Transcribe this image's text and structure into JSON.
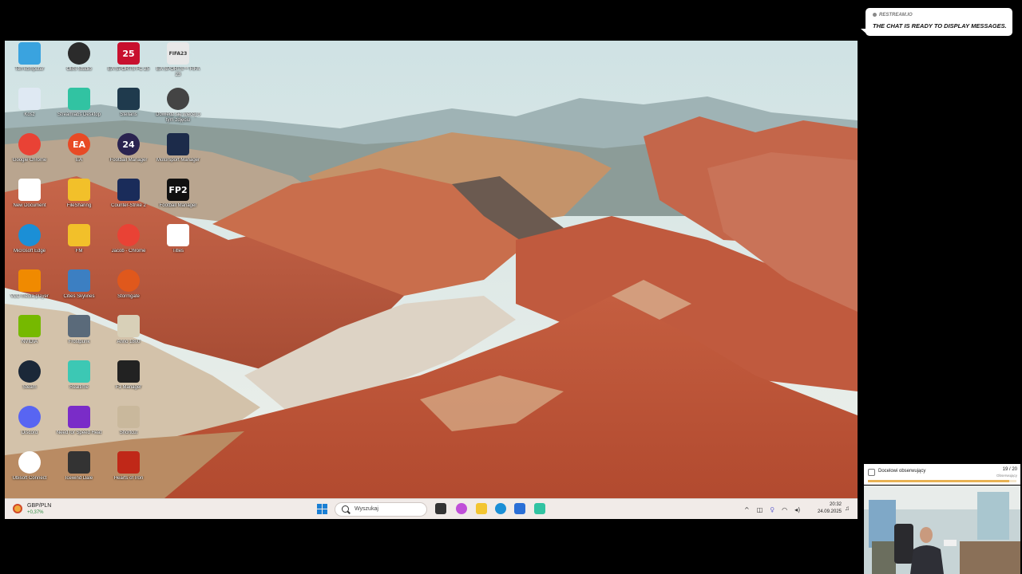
{
  "desktop": {
    "icons": [
      {
        "label": "Ten komputer",
        "icon": "monitor-icon",
        "color": "#3aa3df"
      },
      {
        "label": "OBS Studio",
        "icon": "obs-icon",
        "color": "#2b2b2b"
      },
      {
        "label": "EA SPORTS FC 25",
        "icon": "fc25-icon",
        "color": "#c8102e",
        "text": "25"
      },
      {
        "label": "EA SPORTS™ FIFA 23",
        "icon": "fifa23-icon",
        "color": "#e8e8e8",
        "text": "FIFA23"
      },
      {
        "label": "Kosz",
        "icon": "recycle-bin-icon",
        "color": "#dfe9f3"
      },
      {
        "label": "Streamlabs Desktop",
        "icon": "streamlabs-icon",
        "color": "#31c3a2"
      },
      {
        "label": "Stellaris",
        "icon": "stellaris-icon",
        "color": "#1f3a4d"
      },
      {
        "label": "Dowiedz się więcej o tym zdjęciu",
        "icon": "camera-icon",
        "color": "#444444"
      },
      {
        "label": "Google Chrome",
        "icon": "chrome-icon",
        "color": "#e94235"
      },
      {
        "label": "EA",
        "icon": "ea-icon",
        "color": "#e84a25",
        "text": "EA"
      },
      {
        "label": "Football Manager",
        "icon": "fm24-icon",
        "color": "#2a2350",
        "text": "24"
      },
      {
        "label": "Motorsport Manager",
        "icon": "mm-icon",
        "color": "#1c2b4a"
      },
      {
        "label": "New Document",
        "icon": "document-icon",
        "color": "#ffffff"
      },
      {
        "label": "FileSharing",
        "icon": "folder-icon",
        "color": "#f2c02a"
      },
      {
        "label": "Counter-Strike 2",
        "icon": "cs2-icon",
        "color": "#1a2c5a"
      },
      {
        "label": "Football Manager",
        "icon": "fm2-icon",
        "color": "#111111",
        "text": "FP2"
      },
      {
        "label": "Microsoft Edge",
        "icon": "edge-icon",
        "color": "#1b8fd6"
      },
      {
        "label": "FM",
        "icon": "folder-icon",
        "color": "#f2c02a"
      },
      {
        "label": "Jacob - Chrome",
        "icon": "chrome-profile-icon",
        "color": "#e94235"
      },
      {
        "label": "Titles",
        "icon": "document-icon",
        "color": "#ffffff"
      },
      {
        "label": "VLC media player",
        "icon": "vlc-icon",
        "color": "#f08a00"
      },
      {
        "label": "Cities Skylines",
        "icon": "cities-icon",
        "color": "#3c7fc2"
      },
      {
        "label": "Stormgate",
        "icon": "stormgate-icon",
        "color": "#e0581c"
      },
      {
        "label": "NVIDIA",
        "icon": "nvidia-icon",
        "color": "#76b900"
      },
      {
        "label": "Frostpunk",
        "icon": "frostpunk-icon",
        "color": "#5a6a7a"
      },
      {
        "label": "Anno 1800",
        "icon": "anno-icon",
        "color": "#d8d0b8"
      },
      {
        "label": "Steam",
        "icon": "steam-icon",
        "color": "#1b2838"
      },
      {
        "label": "Realtime",
        "icon": "realtime-icon",
        "color": "#3cc8b4"
      },
      {
        "label": "F1 Manager",
        "icon": "f1-icon",
        "color": "#222222"
      },
      {
        "label": "Discord",
        "icon": "discord-icon",
        "color": "#5865f2"
      },
      {
        "label": "Need for Speed Heat",
        "icon": "nfs-icon",
        "color": "#7a2cc8"
      },
      {
        "label": "Shortcut",
        "icon": "shortcut-icon",
        "color": "#c9b89c"
      },
      {
        "label": "Ubisoft Connect",
        "icon": "ubisoft-icon",
        "color": "#ffffff"
      },
      {
        "label": "Icewind Dale",
        "icon": "game-icon",
        "color": "#333333"
      },
      {
        "label": "Hearts of Iron",
        "icon": "hoi-icon",
        "color": "#c02818"
      }
    ]
  },
  "taskbar": {
    "weather": {
      "title": "GBP/PLN",
      "change": "+0,37%"
    },
    "search_placeholder": "Wyszukaj",
    "apps": [
      {
        "icon": "task-view-icon",
        "color": "#333333"
      },
      {
        "icon": "copilot-icon",
        "color": "#c04fd8"
      },
      {
        "icon": "file-explorer-icon",
        "color": "#f3c531"
      },
      {
        "icon": "edge-icon",
        "color": "#1b8fd6"
      },
      {
        "icon": "store-icon",
        "color": "#2a6fd6"
      },
      {
        "icon": "streamlabs-icon",
        "color": "#31c3a2"
      }
    ],
    "tray_icons": [
      "chevron-up-icon",
      "network-icon",
      "microphone-icon",
      "wifi-icon",
      "volume-icon"
    ],
    "time": "20:32",
    "date": "24.09.2025"
  },
  "chat_overlay": {
    "source": "Restream.io",
    "message": "The chat is ready to display messages."
  },
  "follower_goal": {
    "title": "Docelowi obserwujący",
    "count": "19 / 20",
    "subtitle": "Obserwujący",
    "progress": 0.95,
    "accent": "#e8b254"
  }
}
